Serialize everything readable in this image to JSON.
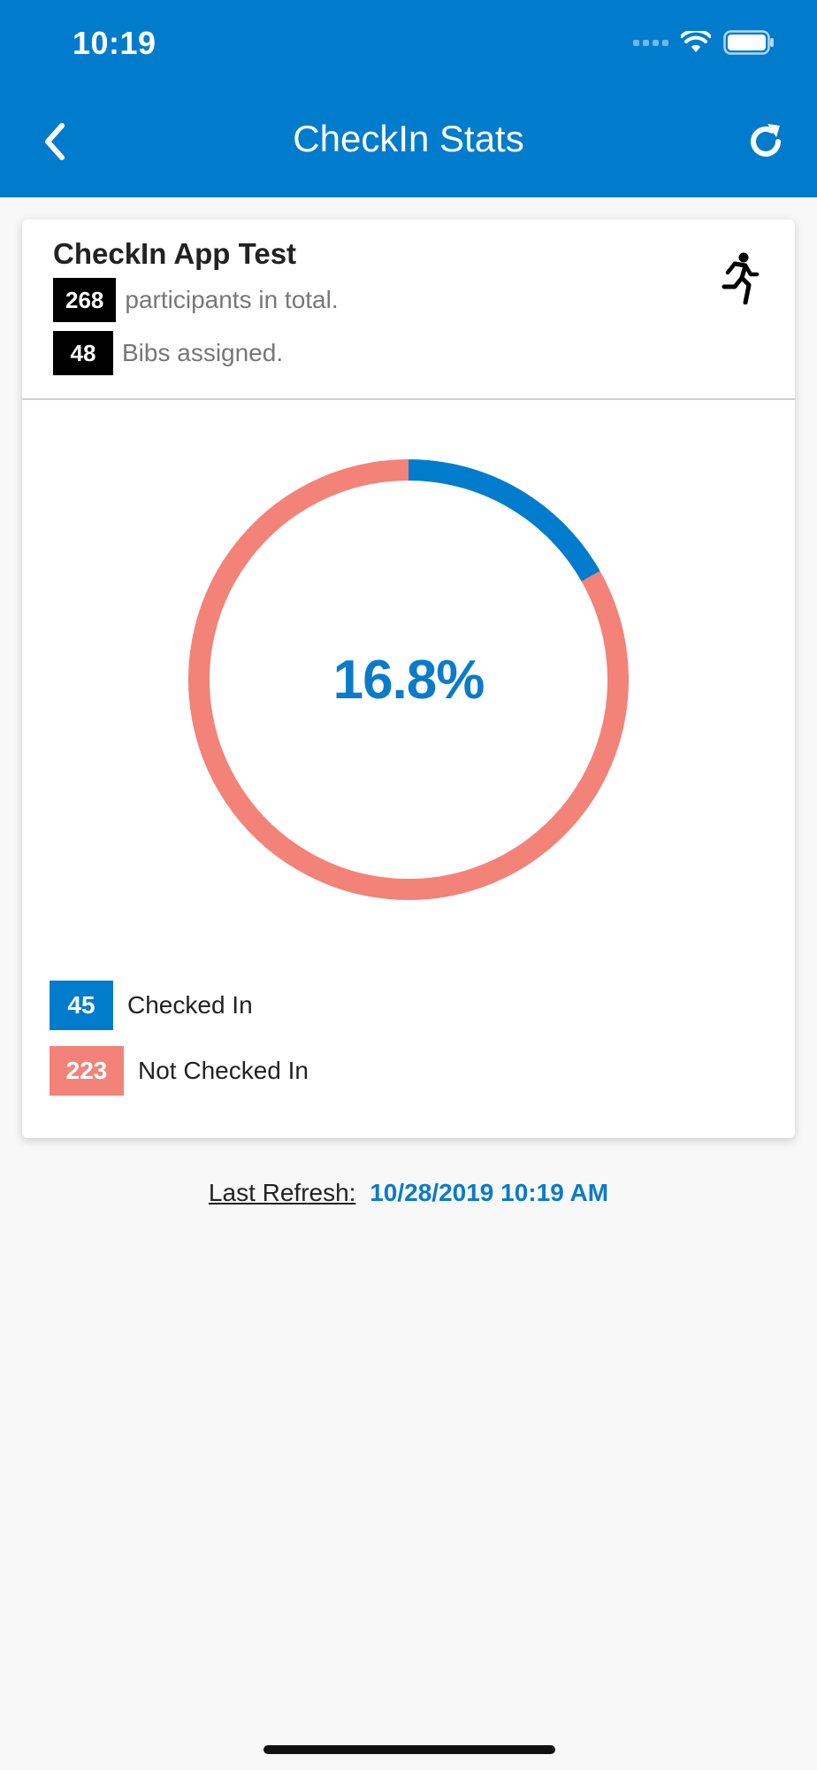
{
  "status_bar": {
    "time": "10:19"
  },
  "header": {
    "title": "CheckIn Stats"
  },
  "event": {
    "name": "CheckIn App Test",
    "participants_count": "268",
    "participants_text": "participants in total.",
    "bibs_count": "48",
    "bibs_text": "Bibs assigned."
  },
  "chart_data": {
    "type": "pie",
    "center_label": "16.8%",
    "series": [
      {
        "name": "Checked In",
        "value": 45,
        "color": "#017ccd"
      },
      {
        "name": "Not Checked In",
        "value": 223,
        "color": "#f38279"
      }
    ]
  },
  "legend": [
    {
      "count": "45",
      "label": "Checked In",
      "color": "#017ccd"
    },
    {
      "count": "223",
      "label": "Not Checked In",
      "color": "#f38279"
    }
  ],
  "footer": {
    "last_refresh_label": "Last Refresh:",
    "last_refresh_value": "10/28/2019 10:19 AM"
  },
  "icons": [
    "back-arrow-icon",
    "refresh-icon",
    "runner-icon",
    "wifi-icon",
    "battery-icon",
    "signal-icon"
  ]
}
